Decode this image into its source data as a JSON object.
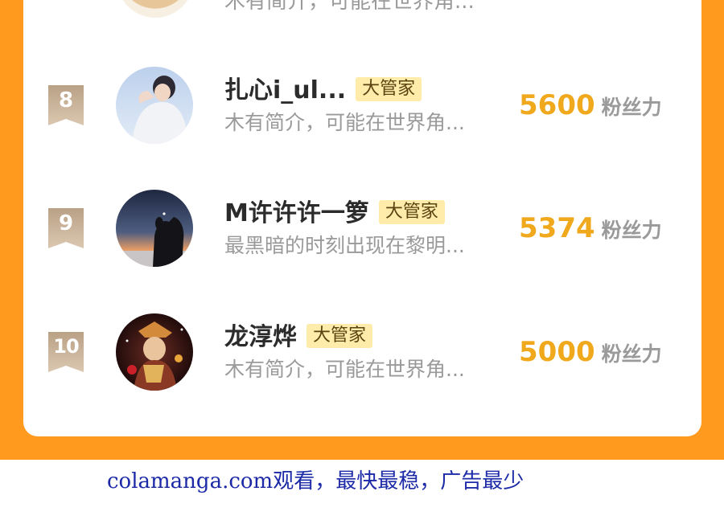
{
  "partial_row": {
    "description": "木有简介，可能在世界角..."
  },
  "rows": [
    {
      "rank": "8",
      "name": "扎心i_ul...",
      "role": "大管家",
      "description": "木有简介，可能在世界角...",
      "fans_count": "5600",
      "fans_unit": "粉丝力",
      "avatar": "avatar-boy-light-icon"
    },
    {
      "rank": "9",
      "name": "M许许许一箩",
      "role": "大管家",
      "description": "最黑暗的时刻出现在黎明...",
      "fans_count": "5374",
      "fans_unit": "粉丝力",
      "avatar": "avatar-sunset-icon"
    },
    {
      "rank": "10",
      "name": "龙淳烨",
      "role": "大管家",
      "description": "木有简介，可能在世界角...",
      "fans_count": "5000",
      "fans_unit": "粉丝力",
      "avatar": "avatar-anime-icon"
    }
  ],
  "footer": {
    "text": "colamanga.com观看，最快最稳，广告最少"
  },
  "colors": {
    "background": "#ff9a1f",
    "fans_count": "#f0a81c",
    "badge": "#c8ae8e",
    "role_tag_bg": "#ffecaa",
    "footer_text": "#1c2aa8"
  }
}
